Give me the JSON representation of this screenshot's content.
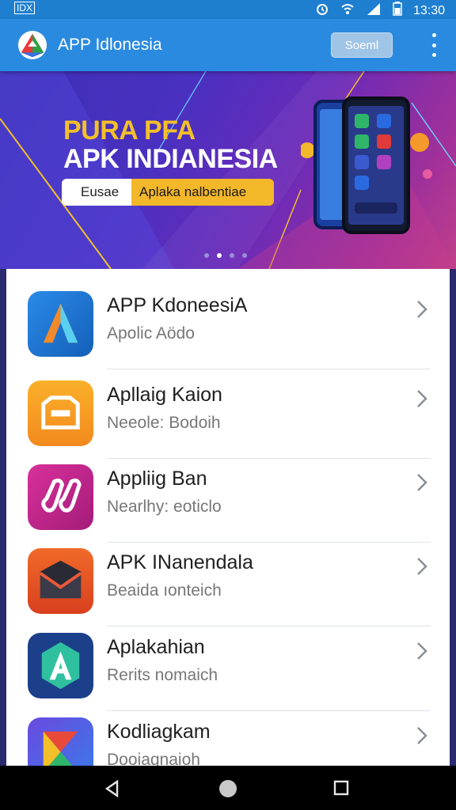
{
  "status_bar": {
    "left_icon": "screen-icon",
    "time": "13:30",
    "icons": [
      "alarm-icon",
      "wifi-icon",
      "signal-icon",
      "battery-icon"
    ]
  },
  "app_bar": {
    "title": "APP Idlonesia",
    "search_label": "Soeml",
    "menu_icon": "more-vert-icon",
    "logo_icon": "app-logo-icon"
  },
  "banner": {
    "line1": "PURA PFA",
    "line2": "APK INDIANESIA",
    "pill_left": "Eusae",
    "pill_right": "Aplaka nalbentiae",
    "pages": 4,
    "active_page": 2,
    "colors": {
      "title_yellow": "#f3c02a",
      "pill_yellow": "#f3b72a"
    }
  },
  "apps": [
    {
      "title": "APP KdoneesiA",
      "subtitle": "Apolic Aödo",
      "icon": "a-triangle-icon",
      "color": "#1f7ad6"
    },
    {
      "title": "Apllaig Kaion",
      "subtitle": "Neeole: Bodoih",
      "icon": "container-icon",
      "color": "#f59a24"
    },
    {
      "title": "Appliig Ban",
      "subtitle": "Nearlhy: eoticlo",
      "icon": "music-notes-icon",
      "color": "#c2248a"
    },
    {
      "title": "APK INanendala",
      "subtitle": "Beaida ıonteich",
      "icon": "mail-icon",
      "color": "#e8552a"
    },
    {
      "title": "Aplakahian",
      "subtitle": "Rerits nomaich",
      "icon": "a-hexagon-icon",
      "color": "#1c3f8a"
    },
    {
      "title": "Kodliagkam",
      "subtitle": "Dooiaqnaioh",
      "icon": "hourglass-icon",
      "color": "#4f5fd6"
    }
  ],
  "nav": {
    "back": "back-icon",
    "home": "home-icon",
    "recents": "recents-icon"
  }
}
